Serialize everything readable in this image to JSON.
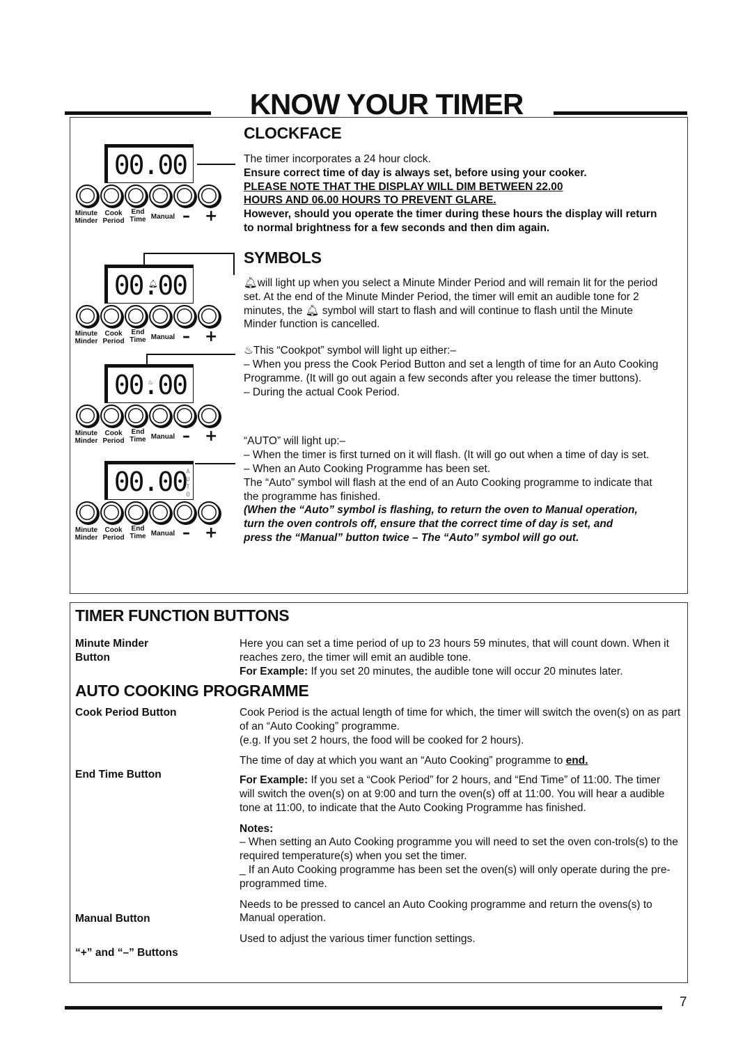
{
  "title": "KNOW YOUR TIMER",
  "timer_labels": {
    "minute": "Minute",
    "minder": "Minder",
    "cook": "Cook",
    "period": "Period",
    "end": "End",
    "time": "Time",
    "manual": "Manual",
    "minus": "–",
    "plus": "+",
    "display": "00.00",
    "auto": "AUTO"
  },
  "clockface": {
    "heading": "CLOCKFACE",
    "p1": "The timer incorporates a 24 hour clock.",
    "p2": "Ensure correct time of day is always set, before using your cooker.",
    "p3a": "PLEASE NOTE THAT THE DISPLAY WILL DIM BETWEEN 22.00",
    "p3b": "HOURS AND 06.00 HOURS TO PREVENT GLARE.",
    "p4": "However, should you operate the timer during these hours the display will return to normal brightness for a few seconds and then dim again."
  },
  "symbols": {
    "heading": "SYMBOLS",
    "bell_1": "will light up when you select a Minute Minder Period and will remain lit for the period set. At the end of the Minute Minder Period, the timer will emit an audible tone for 2 minutes, the",
    "bell_2": "symbol will start to flash and will continue to flash until the Minute Minder function is cancelled.",
    "cookpot_1": "This “Cookpot” symbol will light up either:–",
    "cookpot_2": "– When you press the Cook Period Button and set a length of time for an Auto Cooking Programme. (It will go out again a few seconds after you release the timer buttons).",
    "cookpot_3": "– During the actual Cook Period.",
    "auto_1": "“AUTO” will light up:–",
    "auto_2": "– When the timer is first turned on it will flash. (It will go out when a time of day is set.",
    "auto_3": "– When an Auto Cooking Programme has been set.",
    "auto_4": "The “Auto” symbol will flash at the end of an Auto Cooking programme to indicate that the programme has finished.",
    "auto_note": "(When the “Auto” symbol is flashing, to return the oven to Manual operation, turn the oven controls off, ensure that the correct time of day is set, and press the “Manual” button twice – The “Auto” symbol will go out."
  },
  "functions": {
    "heading": "TIMER FUNCTION BUTTONS",
    "mm_label": "Minute Minder Button",
    "mm_1": "Here you can set a time period of up to 23 hours 59 minutes, that will count down. When it reaches zero, the timer will emit an audible tone.",
    "mm_ex_label": "For Example:",
    "mm_ex": " If you set 20 minutes, the audible tone will occur 20 minutes later."
  },
  "auto_prog": {
    "heading": "AUTO COOKING PROGRAMME",
    "cp_label": "Cook Period Button",
    "cp_1": "Cook Period is the actual length of time for which, the timer will switch the oven(s) on as part of an “Auto Cooking” programme.",
    "cp_2": "(e.g. If you set 2 hours, the food will be cooked for 2 hours).",
    "et_label": "End Time Button",
    "et_1": "The time of day at which you want an “Auto Cooking” programme to ",
    "et_1_end": "end.",
    "et_ex_label": "For Example:",
    "et_ex": " If you set a “Cook Period” for 2 hours, and “End Time” of 11:00. The timer will switch the oven(s) on at 9:00 and turn the oven(s) off at 11:00. You will hear a audible tone at 11:00, to indicate that the Auto Cooking Programme has finished.",
    "notes_label": "Notes:",
    "note_1": "– When setting an Auto Cooking programme you will need to set the oven con-trols(s) to the required temperature(s) when you set the timer.",
    "note_2": "_ If an Auto Cooking programme has been set the oven(s) will only operate during the pre-programmed time.",
    "man_label": "Manual Button",
    "man_1": "Needs to be pressed to cancel an Auto Cooking programme and return the ovens(s) to Manual operation.",
    "pm_label": "“+” and “–” Buttons",
    "pm_1": "Used to adjust the various timer function settings."
  },
  "page_number": "7"
}
